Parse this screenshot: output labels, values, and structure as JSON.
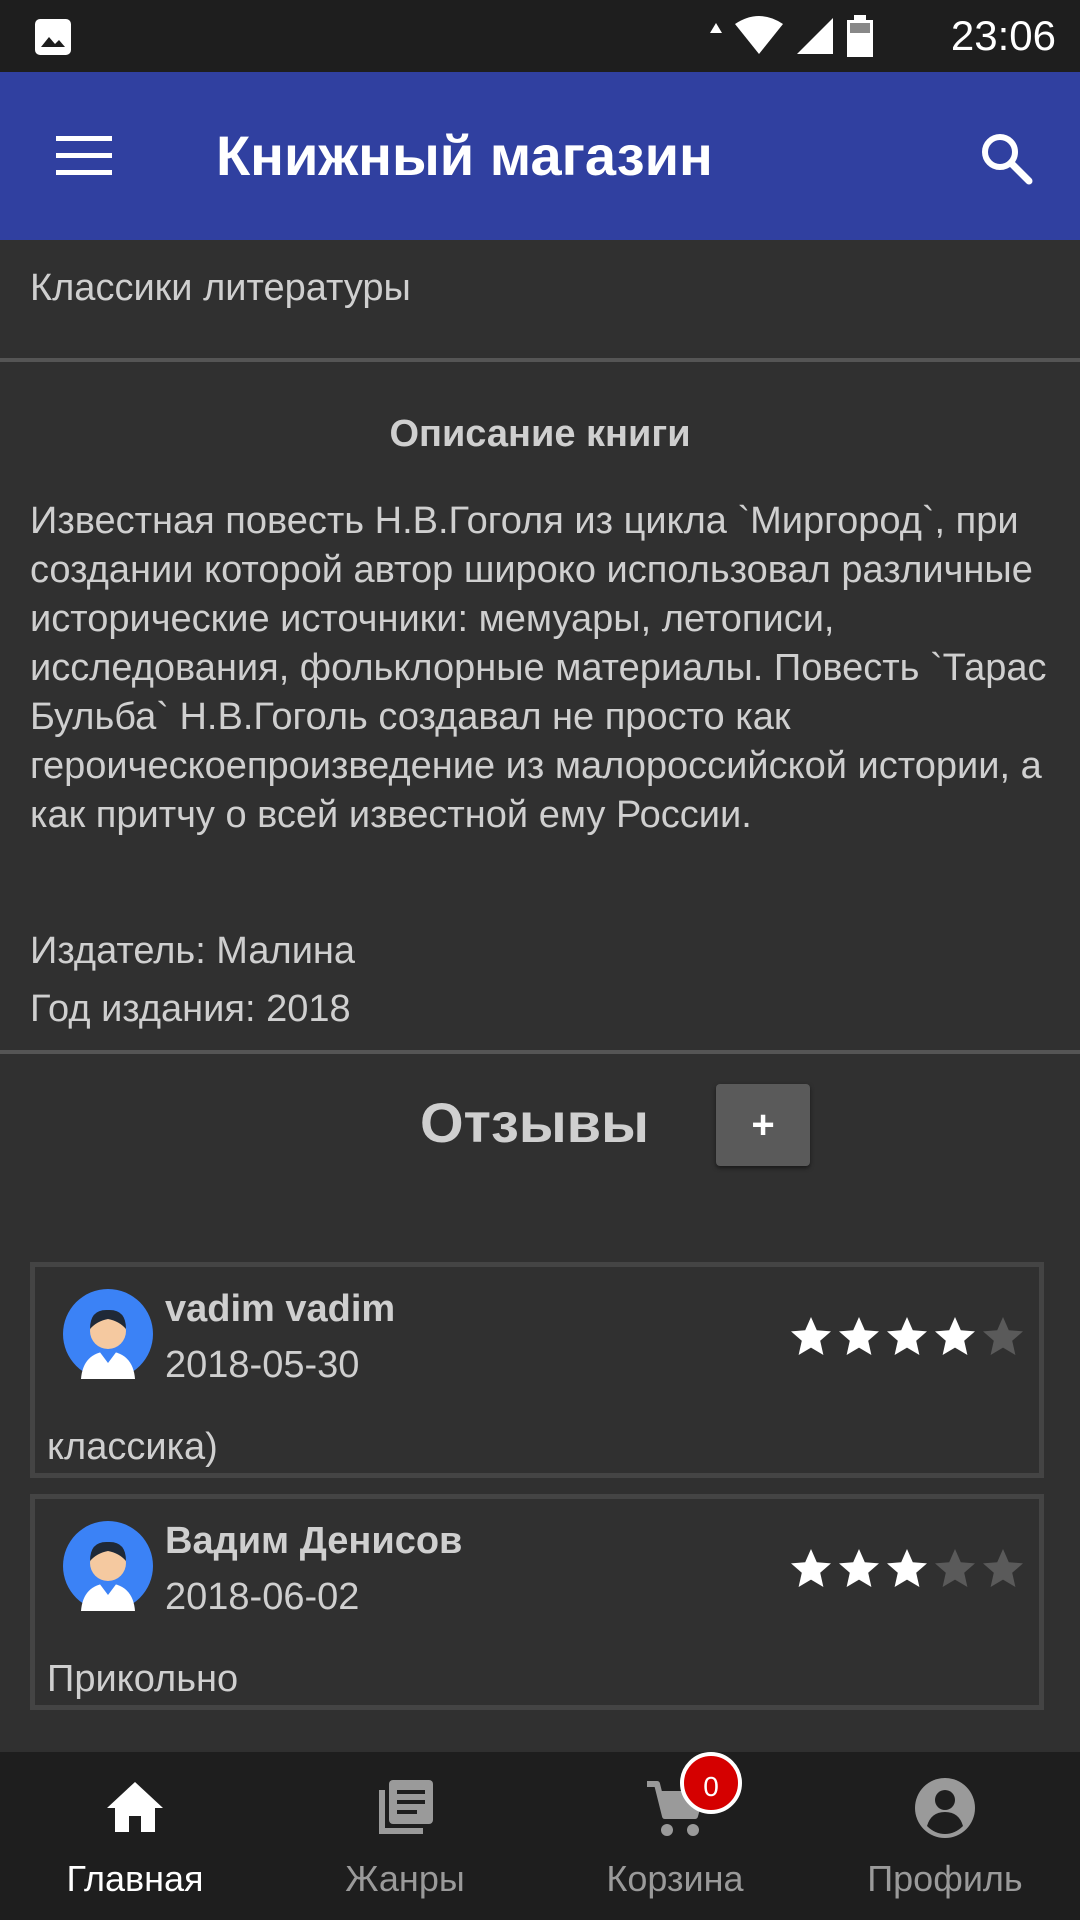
{
  "status_bar": {
    "time": "23:06",
    "icons": [
      "gallery-icon",
      "data-arrows-icon",
      "wifi-icon",
      "signal-icon",
      "battery-icon"
    ]
  },
  "app_bar": {
    "title": "Книжный магазин",
    "menu_icon": "menu-icon",
    "search_icon": "search-icon",
    "color": "#3040a0"
  },
  "book": {
    "category": "Классики литературы",
    "description_heading": "Описание книги",
    "description": "Известная повесть Н.В.Гоголя из цикла `Миргород`, при создании которой автор широко использовал различные исторические источники: мемуары, летописи, исследования, фольклорные материалы. Повесть `Тарас Бульба` Н.В.Гоголь создавал не просто как героическоепроизведение из малороссийской истории, а как притчу о всей известной ему России.",
    "publisher": "Издатель: Малина",
    "year": "Год издания: 2018"
  },
  "reviews": {
    "title": "Отзывы",
    "add_label": "+",
    "items": [
      {
        "author": "vadim vadim",
        "date": "2018-05-30",
        "rating": 4,
        "max_rating": 5,
        "text": "классика)"
      },
      {
        "author": "Вадим Денисов",
        "date": "2018-06-02",
        "rating": 3,
        "max_rating": 5,
        "text": "Прикольно"
      }
    ]
  },
  "bottom_nav": {
    "items": [
      {
        "label": "Главная",
        "icon": "home-icon",
        "active": true
      },
      {
        "label": "Жанры",
        "icon": "library-books-icon",
        "active": false
      },
      {
        "label": "Корзина",
        "icon": "cart-icon",
        "active": false,
        "badge": "0"
      },
      {
        "label": "Профиль",
        "icon": "account-circle-icon",
        "active": false
      }
    ]
  },
  "colors": {
    "background": "#303030",
    "status_bar": "#1e1e1e",
    "badge": "#d50000",
    "star_filled": "#ffffff",
    "star_empty": "#5a5a5a"
  }
}
